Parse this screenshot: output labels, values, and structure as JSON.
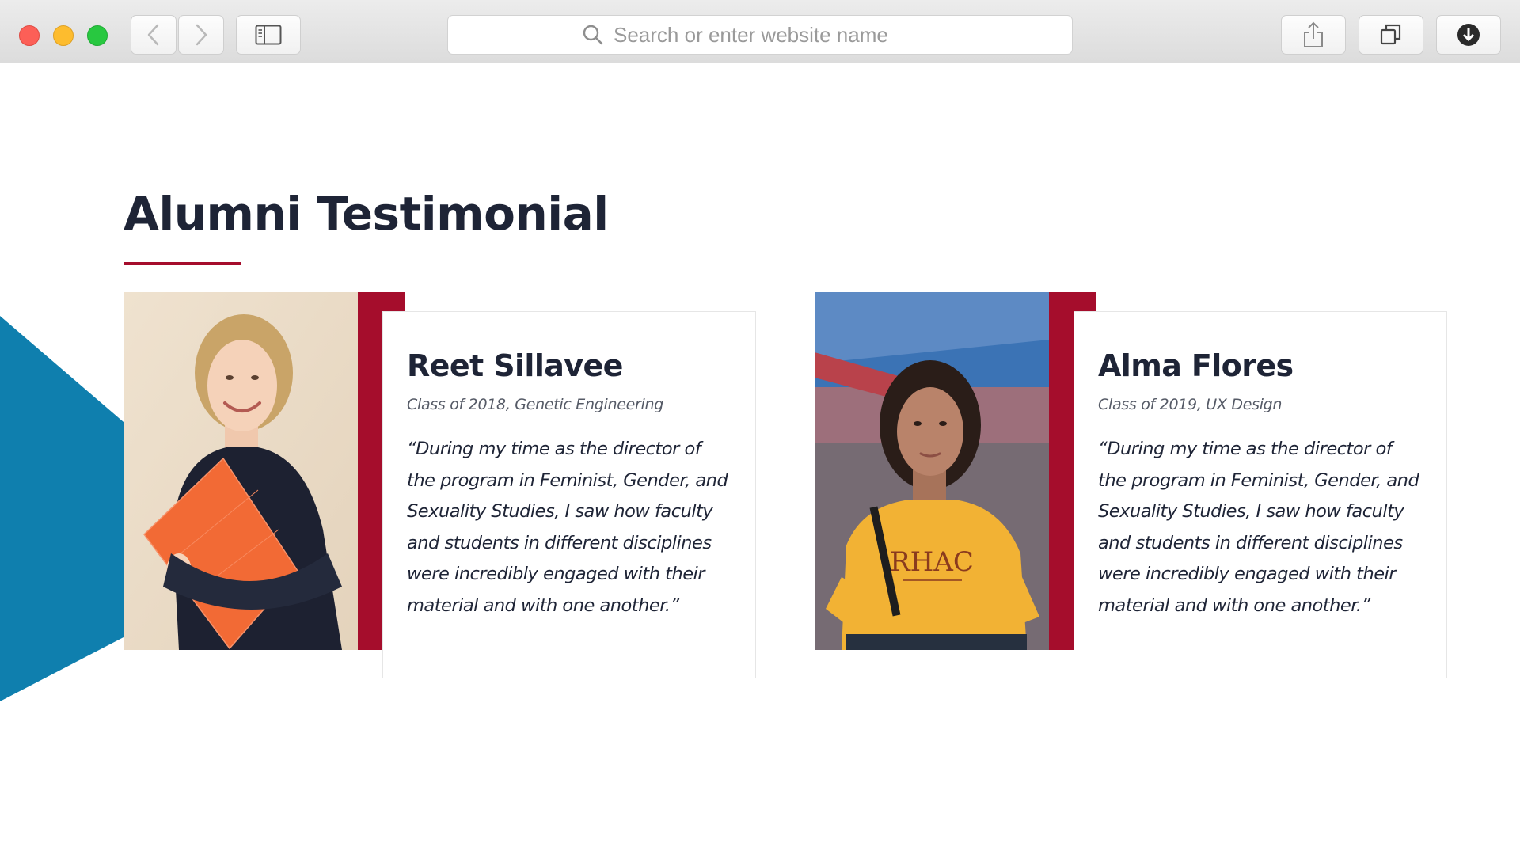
{
  "browser": {
    "search_placeholder": "Search or enter website name"
  },
  "page": {
    "section_title": "Alumni Testimonial",
    "testimonials": [
      {
        "name": "Reet Sillavee",
        "class_info": "Class of 2018, Genetic Engineering",
        "quote": "“During my time as the director of the program in Feminist, Gender, and Sexuality Studies, I saw how faculty and students in different disciplines were incredibly engaged with their material and with one another.”"
      },
      {
        "name": "Alma Flores",
        "class_info": "Class of 2019, UX Design",
        "quote": "“During my time as the director of the program in Feminist, Gender, and Sexuality Studies, I saw how faculty and students in different disciplines were incredibly engaged with their material and with one another.”"
      }
    ]
  },
  "colors": {
    "accent_red": "#a50d2c",
    "accent_teal": "#0f7fae",
    "heading_text": "#1e2436"
  },
  "icons": {
    "back": "chevron-left-icon",
    "forward": "chevron-right-icon",
    "sidebar": "sidebar-icon",
    "search": "search-icon",
    "share": "share-icon",
    "tabs": "tabs-icon",
    "download": "download-icon"
  }
}
